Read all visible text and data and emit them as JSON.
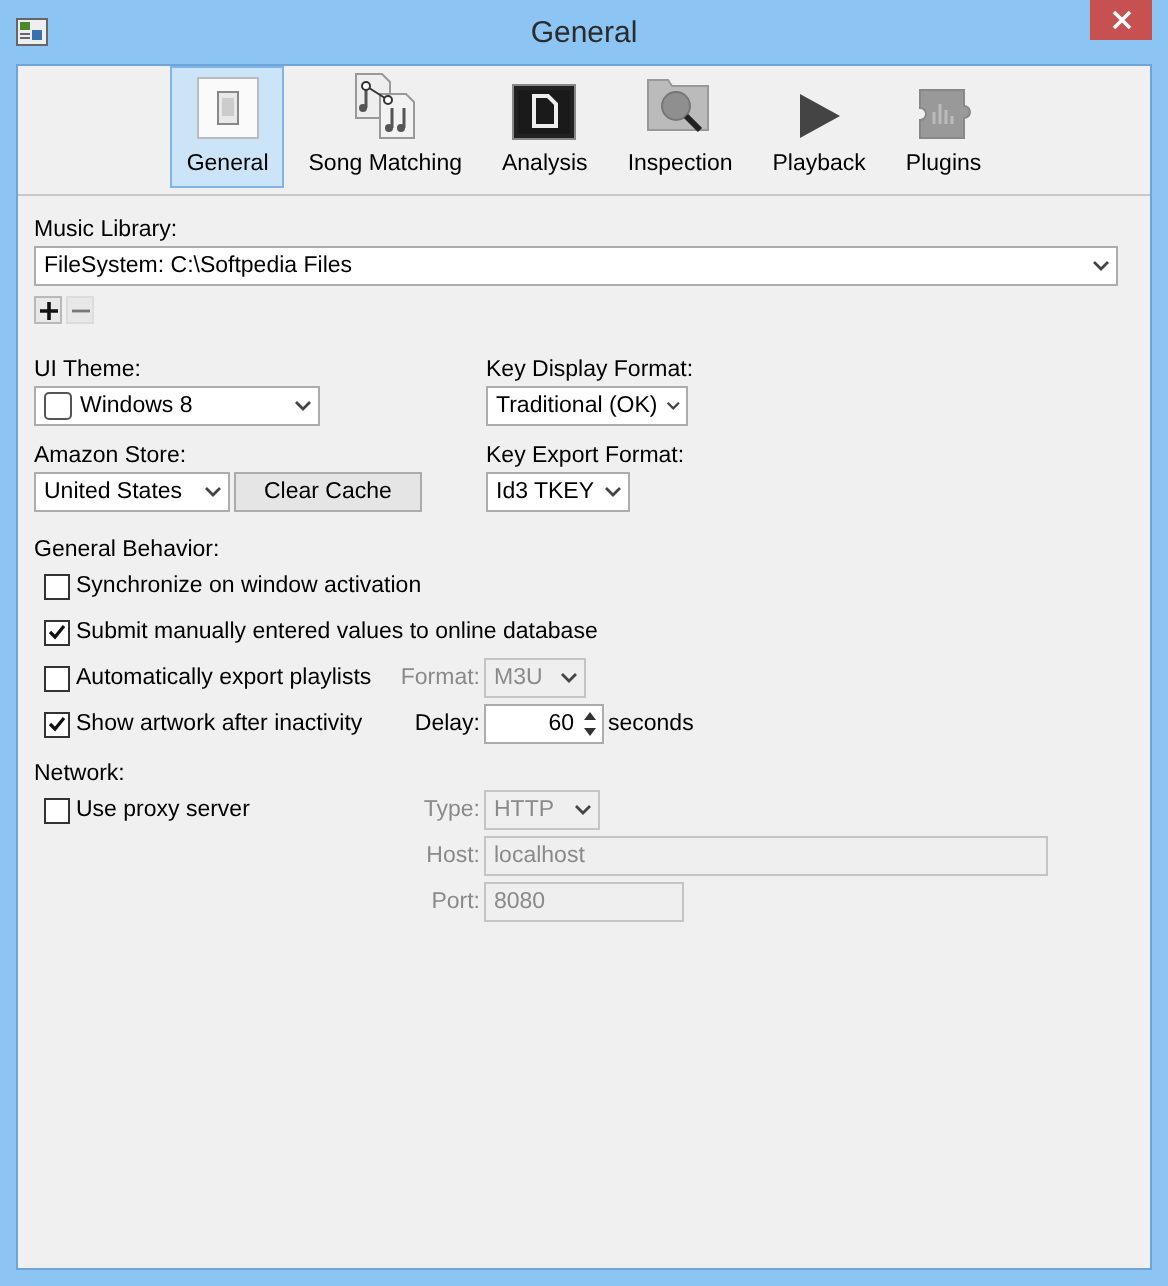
{
  "window": {
    "title": "General"
  },
  "toolbar": [
    {
      "kind": "general",
      "label": "General",
      "selected": true
    },
    {
      "kind": "matching",
      "label": "Song Matching",
      "selected": false
    },
    {
      "kind": "analysis",
      "label": "Analysis",
      "selected": false
    },
    {
      "kind": "inspection",
      "label": "Inspection",
      "selected": false
    },
    {
      "kind": "playback",
      "label": "Playback",
      "selected": false
    },
    {
      "kind": "plugins",
      "label": "Plugins",
      "selected": false
    }
  ],
  "music_library": {
    "label": "Music Library:",
    "value": "FileSystem: C:\\Softpedia Files"
  },
  "ui_theme": {
    "label": "UI Theme:",
    "value": "Windows 8"
  },
  "key_display_format": {
    "label": "Key Display Format:",
    "value": "Traditional (OK)"
  },
  "amazon_store": {
    "label": "Amazon Store:",
    "value": "United States",
    "button": "Clear Cache"
  },
  "key_export_format": {
    "label": "Key Export Format:",
    "value": "Id3 TKEY"
  },
  "general_behavior": {
    "label": "General Behavior:",
    "options": [
      {
        "kind": "plain",
        "label": "Synchronize on window activation",
        "checked": false
      },
      {
        "kind": "plain",
        "label": "Submit manually entered values to online database",
        "checked": true
      },
      {
        "kind": "select",
        "label": "Automatically export playlists",
        "checked": false,
        "field_label": "Format:",
        "value": "M3U",
        "disabled": true
      },
      {
        "kind": "spinner",
        "label": "Show artwork after inactivity",
        "checked": true,
        "field_label": "Delay:",
        "value": "60",
        "unit": "seconds",
        "disabled": false
      }
    ]
  },
  "network": {
    "label": "Network:",
    "proxy": {
      "label": "Use proxy server",
      "checked": false
    },
    "fields": [
      {
        "kind": "select",
        "label": "Type:",
        "value": "HTTP",
        "disabled": true
      },
      {
        "kind": "text",
        "label": "Host:",
        "value": "localhost",
        "disabled": true
      },
      {
        "kind": "text",
        "label": "Port:",
        "value": "8080",
        "disabled": true
      }
    ]
  }
}
